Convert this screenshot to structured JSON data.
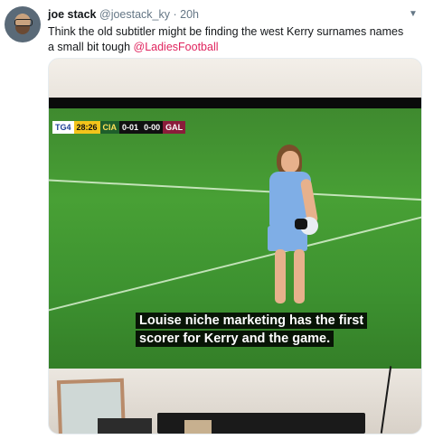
{
  "tweet": {
    "display_name": "joe stack",
    "handle": "@joestack_ky",
    "separator": "·",
    "time": "20h",
    "text": "Think the old subtitler might be finding the west Kerry surnames names a small bit tough",
    "mention": "@LadiesFootball",
    "menu_icon": "chevron-down-icon"
  },
  "media": {
    "scoreboard": {
      "channel": "TG4",
      "clock": "28:26",
      "team1": "CIA",
      "team1_score": "0-01",
      "team2_score": "0-00",
      "team2": "GAL"
    },
    "subtitle_line1": "Louise niche marketing has the first",
    "subtitle_line2": "scorer for Kerry and the game."
  }
}
